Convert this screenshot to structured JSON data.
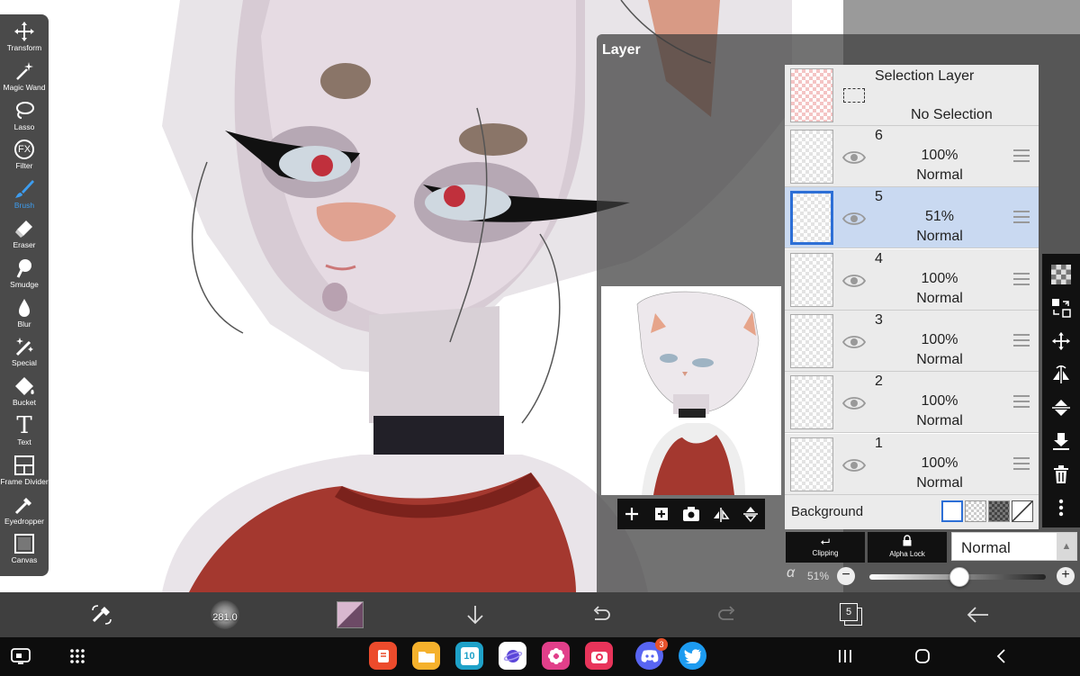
{
  "toolbar": {
    "tools": [
      {
        "label": "Transform",
        "icon": "move-arrows-icon"
      },
      {
        "label": "Magic Wand",
        "icon": "magic-wand-icon"
      },
      {
        "label": "Lasso",
        "icon": "lasso-icon"
      },
      {
        "label": "Filter",
        "icon": "fx-icon",
        "glyph": "FX"
      },
      {
        "label": "Brush",
        "icon": "brush-icon",
        "active": true
      },
      {
        "label": "Eraser",
        "icon": "eraser-icon"
      },
      {
        "label": "Smudge",
        "icon": "smudge-icon"
      },
      {
        "label": "Blur",
        "icon": "blur-drop-icon"
      },
      {
        "label": "Special",
        "icon": "special-icon"
      },
      {
        "label": "Bucket",
        "icon": "bucket-icon"
      },
      {
        "label": "Text",
        "icon": "text-icon",
        "glyph": "T"
      },
      {
        "label": "Frame Divider",
        "icon": "frame-divider-icon"
      },
      {
        "label": "Eyedropper",
        "icon": "eyedropper-icon"
      },
      {
        "label": "Canvas",
        "icon": "canvas-icon"
      }
    ],
    "active_color": "#3d9df0"
  },
  "layer_panel": {
    "title": "Layer",
    "selection_layer": {
      "title": "Selection Layer",
      "status": "No Selection"
    },
    "layers": [
      {
        "number": "6",
        "opacity": "100%",
        "blend": "Normal",
        "active": false
      },
      {
        "number": "5",
        "opacity": "51%",
        "blend": "Normal",
        "active": true
      },
      {
        "number": "4",
        "opacity": "100%",
        "blend": "Normal",
        "active": false
      },
      {
        "number": "3",
        "opacity": "100%",
        "blend": "Normal",
        "active": false
      },
      {
        "number": "2",
        "opacity": "100%",
        "blend": "Normal",
        "active": false
      },
      {
        "number": "1",
        "opacity": "100%",
        "blend": "Normal",
        "active": false
      }
    ],
    "background_label": "Background",
    "clipping_label": "Clipping",
    "alpha_lock_label": "Alpha Lock",
    "blend_mode": "Normal",
    "opacity_symbol": "α",
    "opacity_value": "51%",
    "opacity_fraction": 0.51,
    "minus": "−",
    "plus": "+",
    "active_layer_color": "#c9d9f1",
    "selected_border_color": "#2d6fd6"
  },
  "bottom_bar": {
    "brush_size": "281.0",
    "layer_count": "5"
  },
  "system_nav": {
    "discord_badge": "3",
    "calendar_day": "10"
  }
}
